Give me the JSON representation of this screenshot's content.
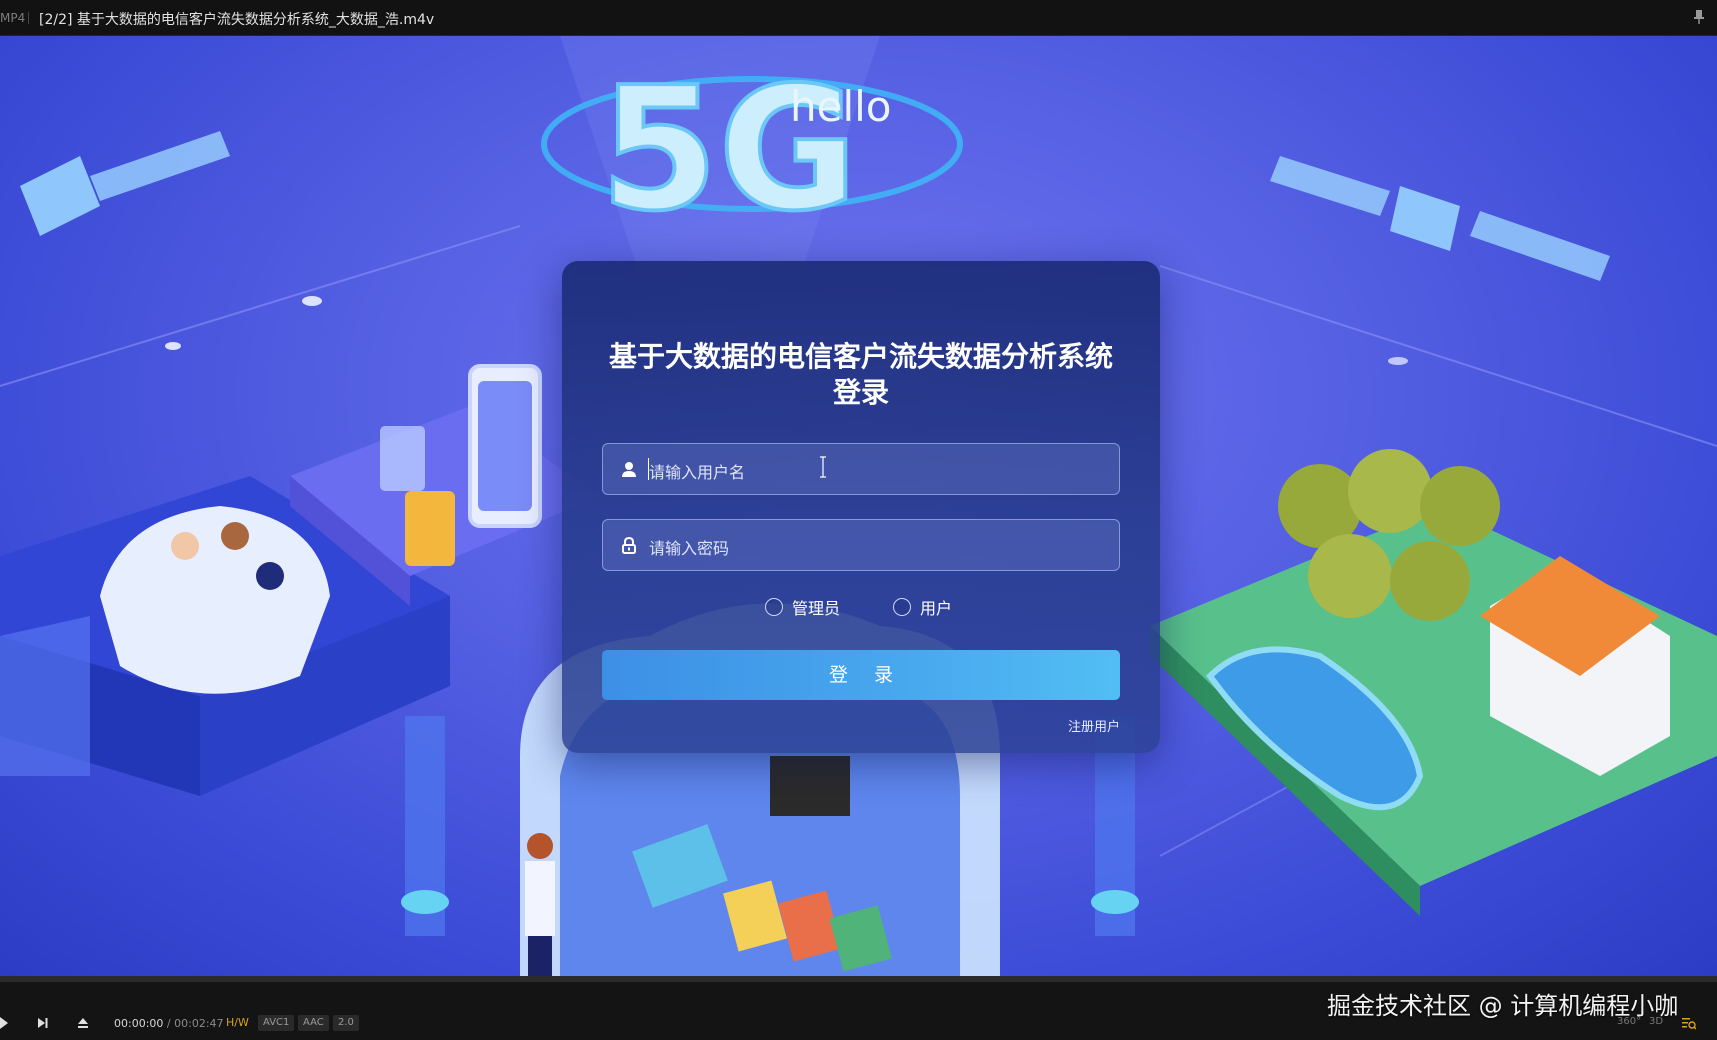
{
  "player": {
    "format": "MP4",
    "file_title": "[2/2] 基于大数据的电信客户流失数据分析系统_大数据_浩.m4v",
    "time_current": "00:00:00",
    "time_separator": "/",
    "time_total": "00:02:47",
    "badges": [
      "H/W",
      "AVC1",
      "AAC",
      "2.0"
    ],
    "right_controls": [
      "360°",
      "3D"
    ],
    "watermark": "掘金技术社区 @ 计算机编程小咖"
  },
  "scene": {
    "logo_text": "5G",
    "logo_hello": "hello"
  },
  "login": {
    "title_line1": "基于大数据的电信客户流失数据分析系统",
    "title_line2": "登录",
    "username_placeholder": "请输入用户名",
    "password_placeholder": "请输入密码",
    "role_admin": "管理员",
    "role_user": "用户",
    "login_button": "登 录",
    "register_link": "注册用户"
  },
  "colors": {
    "background": "#5560e3",
    "button": "#48a9ee",
    "card": "#1c2c78"
  }
}
